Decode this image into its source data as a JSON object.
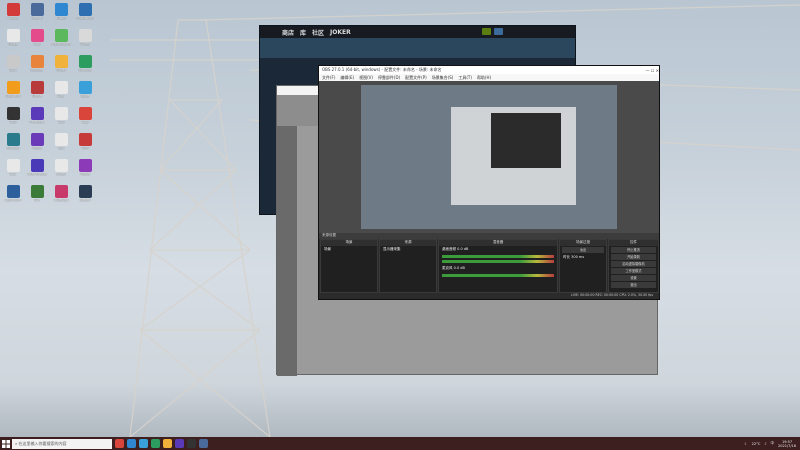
{
  "desktop": {
    "icons": [
      {
        "label": "Adobe",
        "color": "#d33a3a"
      },
      {
        "label": "Steam",
        "color": "#4a6a9c"
      },
      {
        "label": "uTools",
        "color": "#2f86d1"
      },
      {
        "label": "Photoshop",
        "color": "#2d6fb0"
      },
      {
        "label": "Notes",
        "color": "#e8e8e8"
      },
      {
        "label": "App",
        "color": "#e34b8a"
      },
      {
        "label": "Vectorworks",
        "color": "#5cb85c"
      },
      {
        "label": "Video",
        "color": "#d9d9d9"
      },
      {
        "label": "Disk",
        "color": "#c9c9c9"
      },
      {
        "label": "Blender",
        "color": "#e8843b"
      },
      {
        "label": "Folder",
        "color": "#f0b23a"
      },
      {
        "label": "Chrome",
        "color": "#2d9c5f"
      },
      {
        "label": "Illustrator",
        "color": "#f29c1c"
      },
      {
        "label": "Game",
        "color": "#b83a3a"
      },
      {
        "label": "Doc",
        "color": "#e8e8e8"
      },
      {
        "label": "Edge",
        "color": "#3aa0d9"
      },
      {
        "label": "OBS",
        "color": "#333333"
      },
      {
        "label": "Premiere",
        "color": "#5a3ab8"
      },
      {
        "label": "Tool",
        "color": "#e8e8e8"
      },
      {
        "label": "App",
        "color": "#d9453a"
      },
      {
        "label": "Audition",
        "color": "#2a7b8c"
      },
      {
        "label": "Media",
        "color": "#6a3ab8"
      },
      {
        "label": "Text",
        "color": "#e8e8e8"
      },
      {
        "label": "WPS",
        "color": "#c73a3a"
      },
      {
        "label": "Doc",
        "color": "#e8e8e8"
      },
      {
        "label": "After Effects",
        "color": "#4a3ab8"
      },
      {
        "label": "Sheet",
        "color": "#e8e8e8"
      },
      {
        "label": "Media",
        "color": "#8c3ab8"
      },
      {
        "label": "Lightroom",
        "color": "#2d5f9c"
      },
      {
        "label": "Dw",
        "color": "#3a7b3a"
      },
      {
        "label": "InDesign",
        "color": "#c73a6a"
      },
      {
        "label": "Steam",
        "color": "#2a3d55"
      }
    ],
    "network_tower_desc": "power-tower-icon"
  },
  "steam": {
    "nav": [
      "商店",
      "库",
      "社区",
      "JOKER"
    ]
  },
  "obs": {
    "title": "OBS 27.0.1 (64-bit, windows) - 配置文件: 未命名 - 场景: 未命名",
    "menu": [
      "文件(F)",
      "编辑(E)",
      "视图(V)",
      "停靠部件(D)",
      "配置文件(P)",
      "场景集合(S)",
      "工具(T)",
      "帮助(H)"
    ],
    "dock_header": "来源设置",
    "panels": {
      "scenes": {
        "header": "场景",
        "items": [
          "场景"
        ]
      },
      "sources": {
        "header": "来源",
        "items": [
          "显示器采集"
        ]
      },
      "mixer": {
        "header": "混音器",
        "tracks": [
          {
            "name": "桌面音频",
            "value": "0.0 dB"
          },
          {
            "name": "麦克风",
            "value": "0.0 dB"
          }
        ]
      },
      "transitions": {
        "header": "场景过渡",
        "type": "淡出",
        "duration_label": "时长",
        "duration": "300 ms"
      },
      "controls": {
        "header": "控件",
        "buttons": [
          "停止推流",
          "开始录制",
          "启动虚拟摄像机",
          "工作室模式",
          "设置",
          "退出"
        ]
      }
    },
    "status": "LIVE: 00:00:00  REC: 00:00:00  CPU: 2.0%, 30.00 fps"
  },
  "taskbar": {
    "search_placeholder": "在这里输入你要搜索的内容",
    "apps_colors": [
      "#d9453a",
      "#2f86d1",
      "#3aa0d9",
      "#2d9c5f",
      "#f0b23a",
      "#5a3ab8",
      "#333333",
      "#4a6a9c"
    ],
    "weather": "22°C",
    "lang": "中",
    "time": "19:57",
    "date": "2021/7/16"
  },
  "colors": {
    "taskbar_bg": "#3d1f1f",
    "obs_bg": "#2b2b2b",
    "steam_bg": "#1b2838"
  }
}
